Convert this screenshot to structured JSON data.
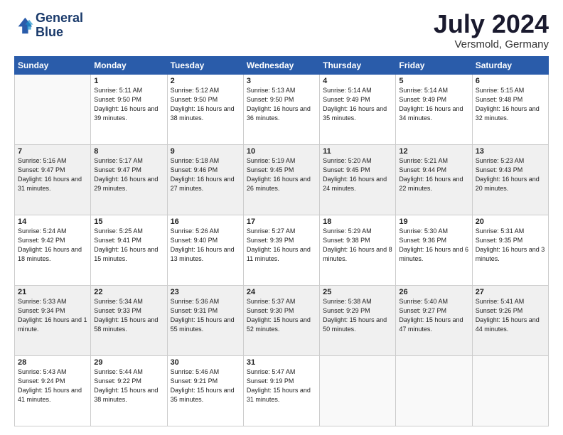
{
  "logo": {
    "line1": "General",
    "line2": "Blue"
  },
  "title": "July 2024",
  "subtitle": "Versmold, Germany",
  "days_header": [
    "Sunday",
    "Monday",
    "Tuesday",
    "Wednesday",
    "Thursday",
    "Friday",
    "Saturday"
  ],
  "weeks": [
    [
      {
        "day": "",
        "info": ""
      },
      {
        "day": "1",
        "info": "Sunrise: 5:11 AM\nSunset: 9:50 PM\nDaylight: 16 hours\nand 39 minutes."
      },
      {
        "day": "2",
        "info": "Sunrise: 5:12 AM\nSunset: 9:50 PM\nDaylight: 16 hours\nand 38 minutes."
      },
      {
        "day": "3",
        "info": "Sunrise: 5:13 AM\nSunset: 9:50 PM\nDaylight: 16 hours\nand 36 minutes."
      },
      {
        "day": "4",
        "info": "Sunrise: 5:14 AM\nSunset: 9:49 PM\nDaylight: 16 hours\nand 35 minutes."
      },
      {
        "day": "5",
        "info": "Sunrise: 5:14 AM\nSunset: 9:49 PM\nDaylight: 16 hours\nand 34 minutes."
      },
      {
        "day": "6",
        "info": "Sunrise: 5:15 AM\nSunset: 9:48 PM\nDaylight: 16 hours\nand 32 minutes."
      }
    ],
    [
      {
        "day": "7",
        "info": "Sunrise: 5:16 AM\nSunset: 9:47 PM\nDaylight: 16 hours\nand 31 minutes."
      },
      {
        "day": "8",
        "info": "Sunrise: 5:17 AM\nSunset: 9:47 PM\nDaylight: 16 hours\nand 29 minutes."
      },
      {
        "day": "9",
        "info": "Sunrise: 5:18 AM\nSunset: 9:46 PM\nDaylight: 16 hours\nand 27 minutes."
      },
      {
        "day": "10",
        "info": "Sunrise: 5:19 AM\nSunset: 9:45 PM\nDaylight: 16 hours\nand 26 minutes."
      },
      {
        "day": "11",
        "info": "Sunrise: 5:20 AM\nSunset: 9:45 PM\nDaylight: 16 hours\nand 24 minutes."
      },
      {
        "day": "12",
        "info": "Sunrise: 5:21 AM\nSunset: 9:44 PM\nDaylight: 16 hours\nand 22 minutes."
      },
      {
        "day": "13",
        "info": "Sunrise: 5:23 AM\nSunset: 9:43 PM\nDaylight: 16 hours\nand 20 minutes."
      }
    ],
    [
      {
        "day": "14",
        "info": "Sunrise: 5:24 AM\nSunset: 9:42 PM\nDaylight: 16 hours\nand 18 minutes."
      },
      {
        "day": "15",
        "info": "Sunrise: 5:25 AM\nSunset: 9:41 PM\nDaylight: 16 hours\nand 15 minutes."
      },
      {
        "day": "16",
        "info": "Sunrise: 5:26 AM\nSunset: 9:40 PM\nDaylight: 16 hours\nand 13 minutes."
      },
      {
        "day": "17",
        "info": "Sunrise: 5:27 AM\nSunset: 9:39 PM\nDaylight: 16 hours\nand 11 minutes."
      },
      {
        "day": "18",
        "info": "Sunrise: 5:29 AM\nSunset: 9:38 PM\nDaylight: 16 hours\nand 8 minutes."
      },
      {
        "day": "19",
        "info": "Sunrise: 5:30 AM\nSunset: 9:36 PM\nDaylight: 16 hours\nand 6 minutes."
      },
      {
        "day": "20",
        "info": "Sunrise: 5:31 AM\nSunset: 9:35 PM\nDaylight: 16 hours\nand 3 minutes."
      }
    ],
    [
      {
        "day": "21",
        "info": "Sunrise: 5:33 AM\nSunset: 9:34 PM\nDaylight: 16 hours\nand 1 minute."
      },
      {
        "day": "22",
        "info": "Sunrise: 5:34 AM\nSunset: 9:33 PM\nDaylight: 15 hours\nand 58 minutes."
      },
      {
        "day": "23",
        "info": "Sunrise: 5:36 AM\nSunset: 9:31 PM\nDaylight: 15 hours\nand 55 minutes."
      },
      {
        "day": "24",
        "info": "Sunrise: 5:37 AM\nSunset: 9:30 PM\nDaylight: 15 hours\nand 52 minutes."
      },
      {
        "day": "25",
        "info": "Sunrise: 5:38 AM\nSunset: 9:29 PM\nDaylight: 15 hours\nand 50 minutes."
      },
      {
        "day": "26",
        "info": "Sunrise: 5:40 AM\nSunset: 9:27 PM\nDaylight: 15 hours\nand 47 minutes."
      },
      {
        "day": "27",
        "info": "Sunrise: 5:41 AM\nSunset: 9:26 PM\nDaylight: 15 hours\nand 44 minutes."
      }
    ],
    [
      {
        "day": "28",
        "info": "Sunrise: 5:43 AM\nSunset: 9:24 PM\nDaylight: 15 hours\nand 41 minutes."
      },
      {
        "day": "29",
        "info": "Sunrise: 5:44 AM\nSunset: 9:22 PM\nDaylight: 15 hours\nand 38 minutes."
      },
      {
        "day": "30",
        "info": "Sunrise: 5:46 AM\nSunset: 9:21 PM\nDaylight: 15 hours\nand 35 minutes."
      },
      {
        "day": "31",
        "info": "Sunrise: 5:47 AM\nSunset: 9:19 PM\nDaylight: 15 hours\nand 31 minutes."
      },
      {
        "day": "",
        "info": ""
      },
      {
        "day": "",
        "info": ""
      },
      {
        "day": "",
        "info": ""
      }
    ]
  ]
}
